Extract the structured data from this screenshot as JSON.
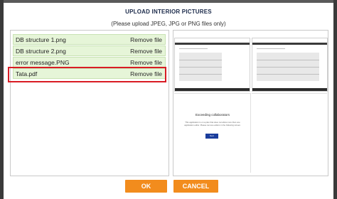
{
  "dialog": {
    "title": "UPLOAD INTERIOR PICTURES",
    "subtitle": "(Please upload JPEG, JPG or PNG files only)"
  },
  "files": [
    {
      "name": "DB structure 1.png",
      "action": "Remove file"
    },
    {
      "name": "DB structure 2.png",
      "action": "Remove file"
    },
    {
      "name": "error message.PNG",
      "action": "Remove file"
    },
    {
      "name": "Tata.pdf",
      "action": "Remove file"
    }
  ],
  "preview": {
    "error_title": "Exceeding collaborators",
    "error_text": "This application is on a plan that does not allow more than one application editor. Please remove editors in the following screen.",
    "error_button": "Next"
  },
  "buttons": {
    "ok": "OK",
    "cancel": "CANCEL"
  },
  "colors": {
    "accent_orange": "#f28c1d",
    "file_row_green": "#e6f5d8",
    "highlight_red": "#d91c24",
    "title_navy": "#1b2a4a"
  }
}
